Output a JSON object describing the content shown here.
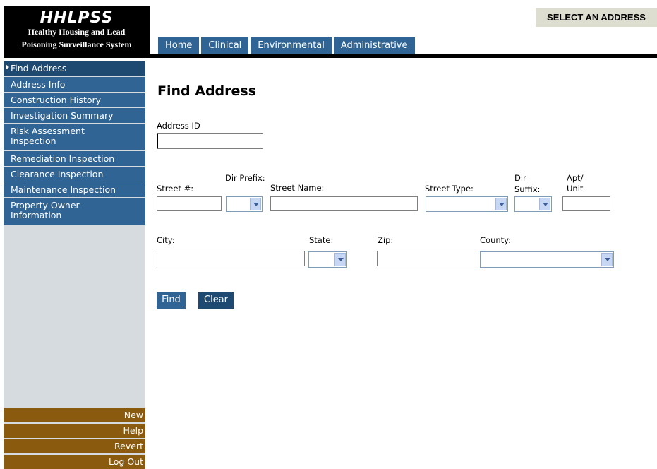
{
  "app": {
    "logo_title": "HHLPSS",
    "logo_line1": "Healthy Housing and Lead",
    "logo_line2": "Poisoning Surveillance System",
    "page_badge": "SELECT AN ADDRESS"
  },
  "tabs": [
    {
      "label": "Home"
    },
    {
      "label": "Clinical"
    },
    {
      "label": "Environmental"
    },
    {
      "label": "Administrative"
    }
  ],
  "sidebar": {
    "items": [
      {
        "label": "Find Address",
        "active": true
      },
      {
        "label": "Address Info"
      },
      {
        "label": "Construction History"
      },
      {
        "label": "Investigation Summary"
      },
      {
        "label": "Risk Assessment Inspection"
      },
      {
        "label": "Remediation Inspection"
      },
      {
        "label": "Clearance Inspection"
      },
      {
        "label": "Maintenance Inspection"
      },
      {
        "label": "Property Owner Information"
      }
    ],
    "bottom": [
      {
        "label": "New"
      },
      {
        "label": "Help"
      },
      {
        "label": "Revert"
      },
      {
        "label": "Log Out"
      }
    ]
  },
  "main": {
    "title": "Find Address",
    "address_id_label": "Address ID",
    "address_id_value": "",
    "street_num_label": "Street #:",
    "dir_prefix_label": "Dir Prefix:",
    "street_name_label": "Street Name:",
    "street_type_label": "Street Type:",
    "dir_suffix_label_1": "Dir",
    "dir_suffix_label_2": "Suffix:",
    "apt_label_1": "Apt/",
    "apt_label_2": "Unit",
    "city_label": "City:",
    "state_label": "State:",
    "zip_label": "Zip:",
    "county_label": "County:",
    "find_button": "Find",
    "clear_button": "Clear"
  },
  "colors": {
    "nav_blue": "#2f6494",
    "nav_active": "#1e4a72",
    "bottom_brown": "#8a5b0f",
    "sidebar_bg": "#d6dbe0",
    "badge_bg": "#ddddd0"
  }
}
